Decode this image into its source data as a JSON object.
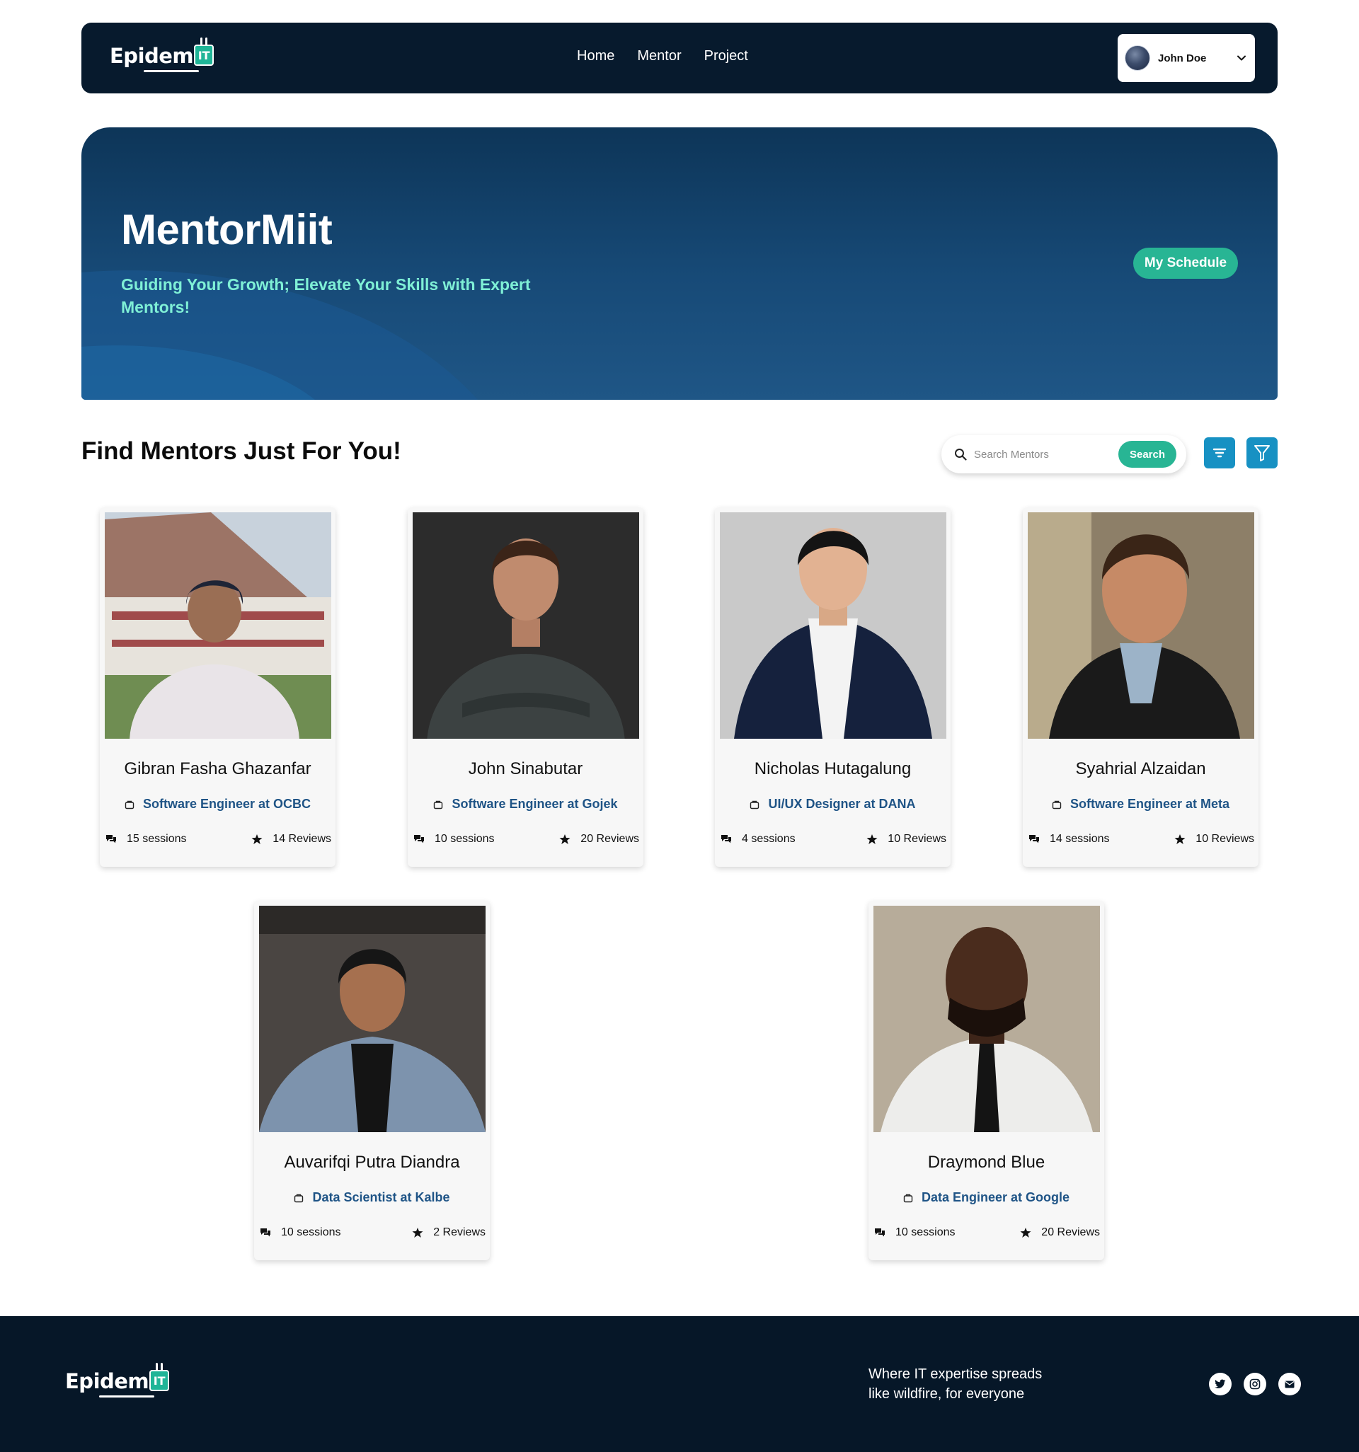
{
  "brand": {
    "word": "Epidem",
    "badge": "IT"
  },
  "nav": {
    "links": [
      "Home",
      "Mentor",
      "Project"
    ],
    "user_name": "John Doe"
  },
  "hero": {
    "title": "MentorMiit",
    "subtitle": "Guiding Your Growth; Elevate Your Skills with Expert Mentors!",
    "schedule_label": "My Schedule"
  },
  "section": {
    "title": "Find Mentors Just For You!",
    "search_placeholder": "Search Mentors",
    "search_label": "Search"
  },
  "mentors": [
    {
      "name": "Gibran Fasha Ghazanfar",
      "role": "Software Engineer at OCBC",
      "sessions": "15 sessions",
      "reviews": "14 Reviews"
    },
    {
      "name": "John Sinabutar",
      "role": "Software Engineer at Gojek",
      "sessions": "10 sessions",
      "reviews": "20 Reviews"
    },
    {
      "name": "Nicholas Hutagalung",
      "role": "UI/UX Designer at DANA",
      "sessions": "4 sessions",
      "reviews": "10 Reviews"
    },
    {
      "name": "Syahrial Alzaidan",
      "role": "Software Engineer at Meta",
      "sessions": "14 sessions",
      "reviews": "10 Reviews"
    },
    {
      "name": "Auvarifqi Putra Diandra",
      "role": "Data Scientist at Kalbe",
      "sessions": "10 sessions",
      "reviews": "2 Reviews"
    },
    {
      "name": "Draymond Blue",
      "role": "Data Engineer at Google",
      "sessions": "10 sessions",
      "reviews": "20 Reviews"
    }
  ],
  "footer": {
    "tagline_line1": "Where IT expertise spreads",
    "tagline_line2": "like wildfire, for everyone",
    "socials": [
      "twitter-icon",
      "instagram-icon",
      "mail-icon"
    ]
  },
  "colors": {
    "navy": "#071a2d",
    "accent": "#28b594",
    "hero_text": "#7ff0d6",
    "role_text": "#1f5486",
    "tool_button": "#1791c3"
  }
}
